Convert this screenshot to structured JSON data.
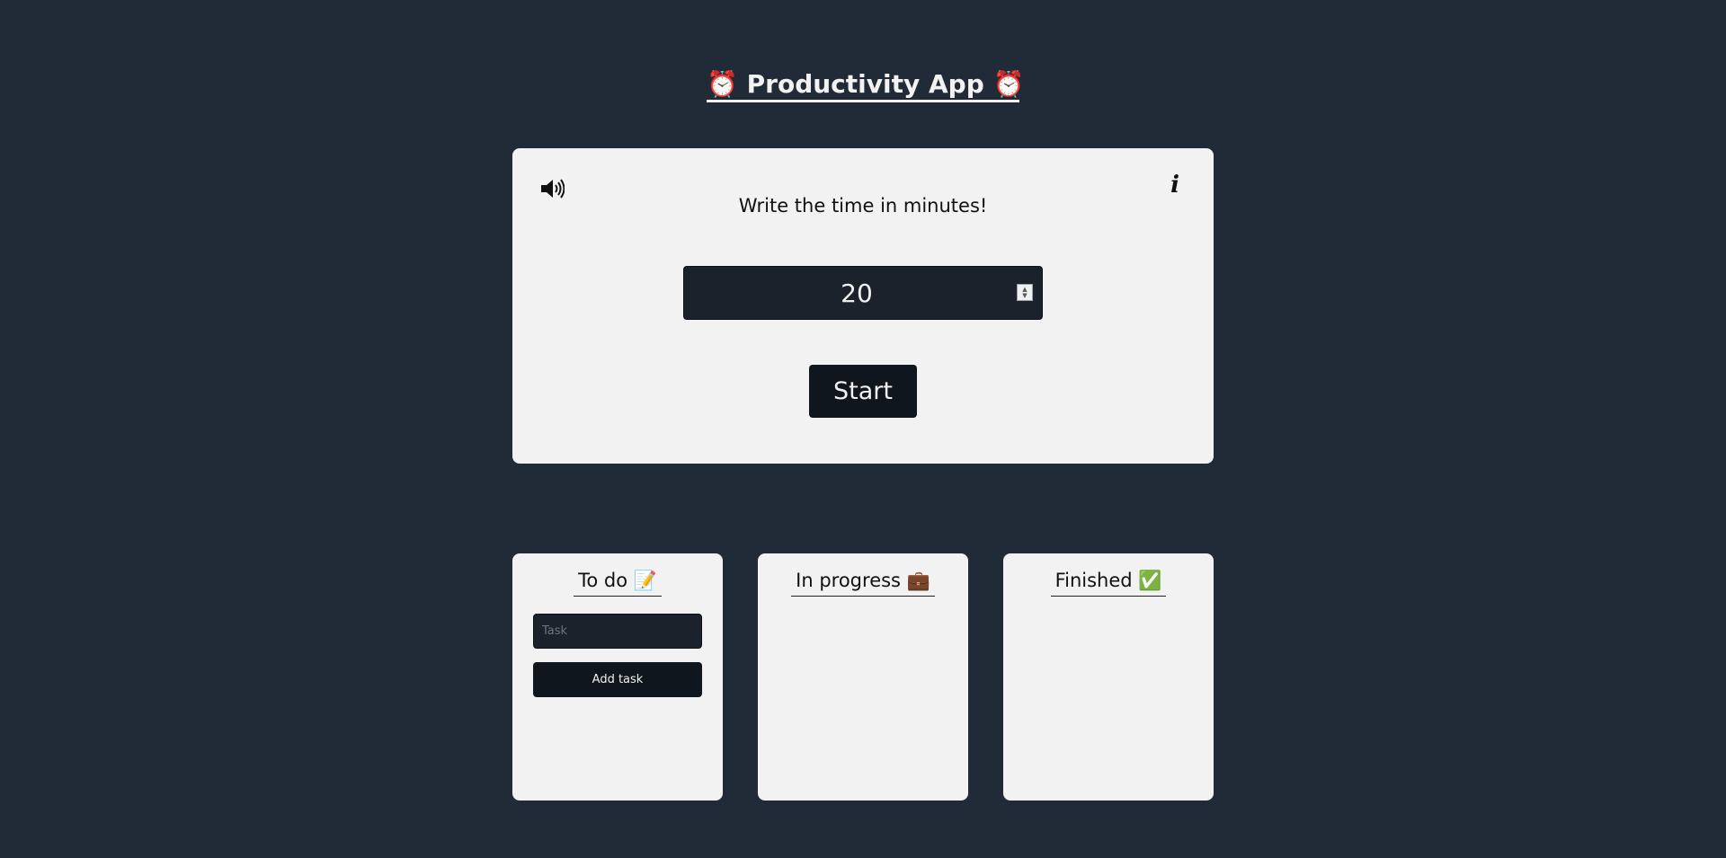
{
  "header": {
    "title": "Productivity App",
    "left_emoji": "⏰",
    "right_emoji": "⏰"
  },
  "timer": {
    "sound_icon": "speaker-volume-icon",
    "info_icon": "info-icon",
    "info_label": "i",
    "prompt": "Write the time in minutes!",
    "minutes_value": "20",
    "start_label": "Start"
  },
  "columns": [
    {
      "id": "todo",
      "title": "To do",
      "emoji": "📝"
    },
    {
      "id": "in-progress",
      "title": "In progress",
      "emoji": "💼"
    },
    {
      "id": "finished",
      "title": "Finished",
      "emoji": "✅"
    }
  ],
  "todo_form": {
    "task_placeholder": "Task",
    "task_value": "",
    "add_task_label": "Add task"
  },
  "colors": {
    "background": "#212b38",
    "card": "#f2f2f2",
    "input_bg": "#1b222c",
    "button_bg": "#0f161d"
  }
}
